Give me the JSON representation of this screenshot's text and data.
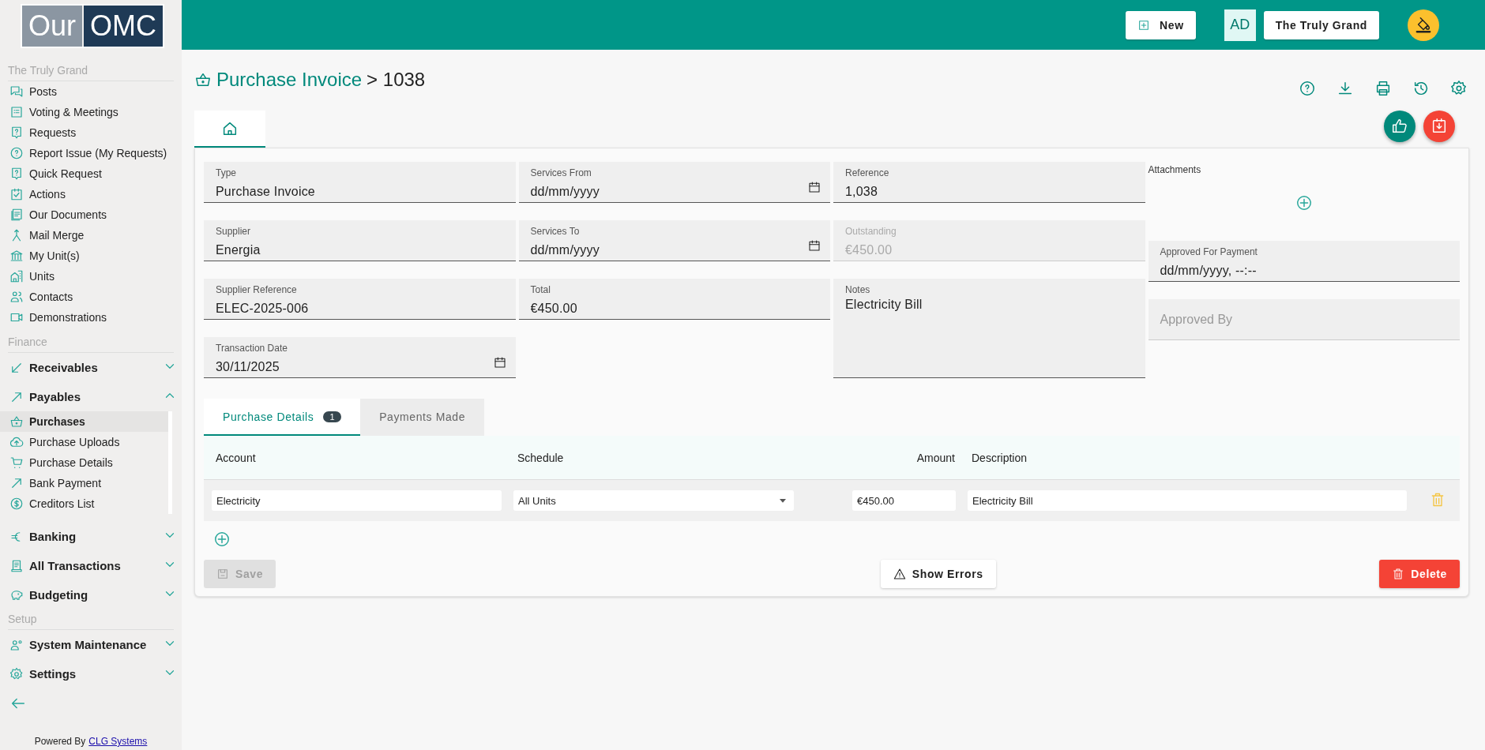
{
  "topbar": {
    "new_button": "New",
    "avatar": "AD",
    "account_button": "The Truly Grand"
  },
  "sidebar": {
    "logo": [
      "Our",
      "OMC"
    ],
    "sections": [
      {
        "title": "The Truly Grand",
        "items": [
          {
            "kind": "link",
            "label": "Posts",
            "selected": false
          },
          {
            "kind": "link",
            "label": "Voting & Meetings",
            "selected": false
          },
          {
            "kind": "link",
            "label": "Requests",
            "selected": false
          },
          {
            "kind": "link",
            "label": "Report Issue (My Requests)",
            "selected": false
          },
          {
            "kind": "link",
            "label": "Quick Request",
            "selected": false
          },
          {
            "kind": "link",
            "label": "Actions",
            "selected": false
          },
          {
            "kind": "link",
            "label": "Our Documents",
            "selected": false
          },
          {
            "kind": "link",
            "label": "Mail Merge",
            "selected": false
          },
          {
            "kind": "link",
            "label": "My Unit(s)",
            "selected": false
          },
          {
            "kind": "link",
            "label": "Units",
            "selected": false
          },
          {
            "kind": "link",
            "label": "Contacts",
            "selected": false
          },
          {
            "kind": "link",
            "label": "Demonstrations",
            "selected": false
          }
        ]
      },
      {
        "title": "Finance",
        "items": [
          {
            "kind": "group",
            "label": "Receivables",
            "expanded": false
          },
          {
            "kind": "group",
            "label": "Payables",
            "expanded": true,
            "children": [
              {
                "label": "Purchases",
                "selected": true
              },
              {
                "label": "Purchase Uploads",
                "selected": false
              },
              {
                "label": "Purchase Details",
                "selected": false
              },
              {
                "label": "Bank Payment",
                "selected": false
              },
              {
                "label": "Creditors List",
                "selected": false
              }
            ]
          },
          {
            "kind": "group",
            "label": "Banking",
            "expanded": false
          },
          {
            "kind": "group",
            "label": "All Transactions",
            "expanded": false
          },
          {
            "kind": "group",
            "label": "Budgeting",
            "expanded": false
          }
        ]
      },
      {
        "title": "Setup",
        "items": [
          {
            "kind": "group",
            "label": "System Maintenance",
            "expanded": false
          },
          {
            "kind": "group",
            "label": "Settings",
            "expanded": false
          }
        ]
      }
    ],
    "footer": {
      "text": "Powered By",
      "link": "CLG Systems"
    }
  },
  "header": {
    "link": "Purchase Invoice",
    "current": "> 1038"
  },
  "page_tabs": [
    {
      "selected": true
    }
  ],
  "form": {
    "columns": [
      {
        "fields": [
          {
            "kind": "text",
            "label": "Type",
            "value": "Purchase Invoice"
          },
          {
            "kind": "text",
            "label": "Supplier",
            "value": "Energia"
          },
          {
            "kind": "text",
            "label": "Supplier Reference",
            "value": "ELEC-2025-006"
          },
          {
            "kind": "date",
            "label": "Transaction Date",
            "value": "30/11/2025"
          }
        ]
      },
      {
        "fields": [
          {
            "kind": "date",
            "label": "Services From",
            "placeholder": "dd/mm/yyyy"
          },
          {
            "kind": "date",
            "label": "Services To",
            "placeholder": "dd/mm/yyyy"
          },
          {
            "kind": "text",
            "label": "Total",
            "value": "€450.00"
          }
        ]
      },
      {
        "fields": [
          {
            "kind": "text",
            "label": "Reference",
            "value": "1,038"
          },
          {
            "kind": "readonly",
            "label": "Outstanding",
            "value": "€450.00"
          },
          {
            "kind": "notes",
            "label": "Notes",
            "value": "Electricity Bill"
          }
        ]
      },
      {
        "fields": [
          {
            "kind": "attachments",
            "label": "Attachments"
          },
          {
            "kind": "text",
            "label": "Approved For Payment",
            "placeholder": "dd/mm/yyyy, --:--"
          },
          {
            "kind": "empty-readonly",
            "label": "Approved By"
          }
        ]
      }
    ]
  },
  "details": {
    "tabs": [
      {
        "label": "Purchase Details",
        "badge": "1",
        "selected": true
      },
      {
        "label": "Payments Made",
        "selected": false
      }
    ],
    "table": {
      "columns": [
        "Account",
        "Schedule",
        "Amount",
        "Description"
      ],
      "rows": [
        {
          "account": "Electricity",
          "schedule": "All Units",
          "amount": "€450.00",
          "description": "Electricity Bill"
        }
      ]
    },
    "buttons": [
      {
        "kind": "save",
        "label": "Save",
        "disabled": true
      },
      {
        "kind": "warning",
        "label": "Show Errors",
        "disabled": false
      },
      {
        "kind": "danger",
        "label": "Delete",
        "disabled": false
      }
    ]
  }
}
